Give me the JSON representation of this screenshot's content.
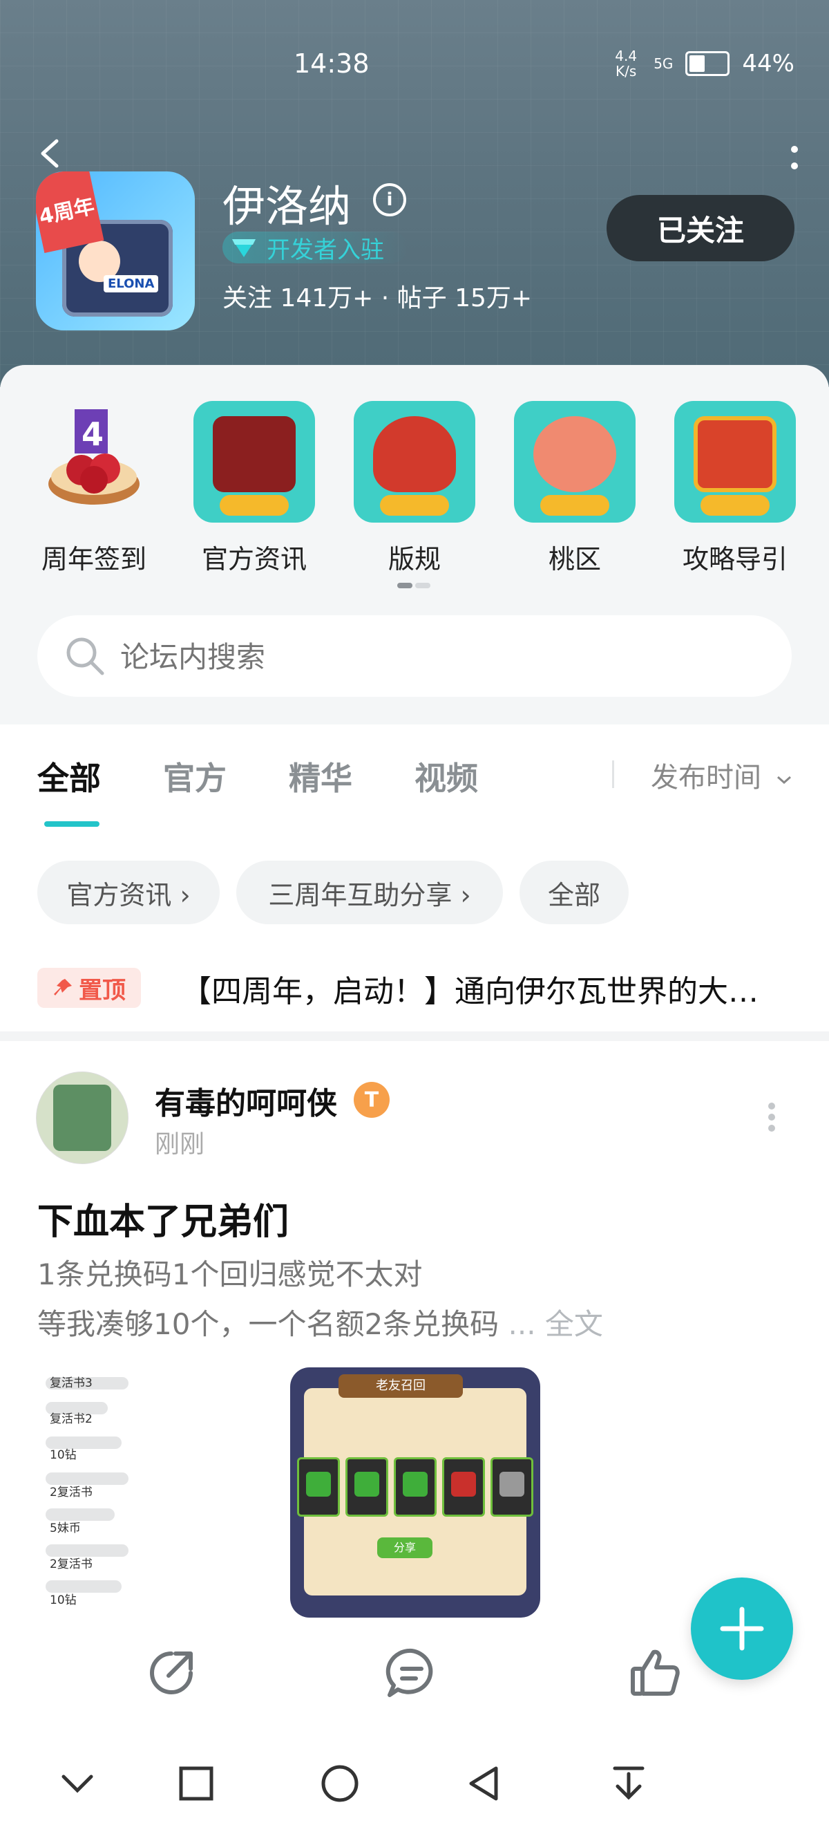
{
  "status_bar": {
    "time": "14:38",
    "net_speed": "4.4 K/s",
    "signal": "5G",
    "battery": "44%"
  },
  "header": {
    "title": "伊洛纳",
    "developer_badge": "开发者入驻",
    "stats": "关注 141万+ · 帖子 15万+",
    "follow_button": "已关注",
    "app_icon_tag": "4周年",
    "app_icon_brand": "ELONA"
  },
  "shortcuts": [
    {
      "label": "周年签到",
      "color": "#c9302c"
    },
    {
      "label": "官方资讯",
      "color": "#9b1d1d"
    },
    {
      "label": "版规",
      "color": "#c0392b"
    },
    {
      "label": "桃区",
      "color": "#e86e5a"
    },
    {
      "label": "攻略导引",
      "color": "#d64228"
    }
  ],
  "search": {
    "placeholder": "论坛内搜索"
  },
  "tabs": [
    {
      "label": "全部",
      "active": true
    },
    {
      "label": "官方"
    },
    {
      "label": "精华"
    },
    {
      "label": "视频"
    }
  ],
  "sort": {
    "label": "发布时间"
  },
  "chips": [
    {
      "label": "官方资讯 ›"
    },
    {
      "label": "三周年互助分享 ›"
    },
    {
      "label": "全部"
    }
  ],
  "pinned": {
    "badge": "置顶",
    "title": "【四周年，启动！】通向伊尔瓦世界的大…"
  },
  "post": {
    "author": "有毒的呵呵侠",
    "level": "T",
    "time": "刚刚",
    "title": "下血本了兄弟们",
    "line1": "1条兑换码1个回归感觉不太对",
    "line2": "等我凑够10个，一个名额2条兑换码",
    "more": " ... 全文",
    "image1_lines": [
      "复活书3",
      "复活书2",
      "10钻",
      "2复活书",
      "5妹币",
      "2复活书",
      "10钻"
    ],
    "image2": {
      "header": "老友召回",
      "share": "分享"
    }
  },
  "colors": {
    "accent": "#23c4c9",
    "pin_red": "#f1594a"
  }
}
